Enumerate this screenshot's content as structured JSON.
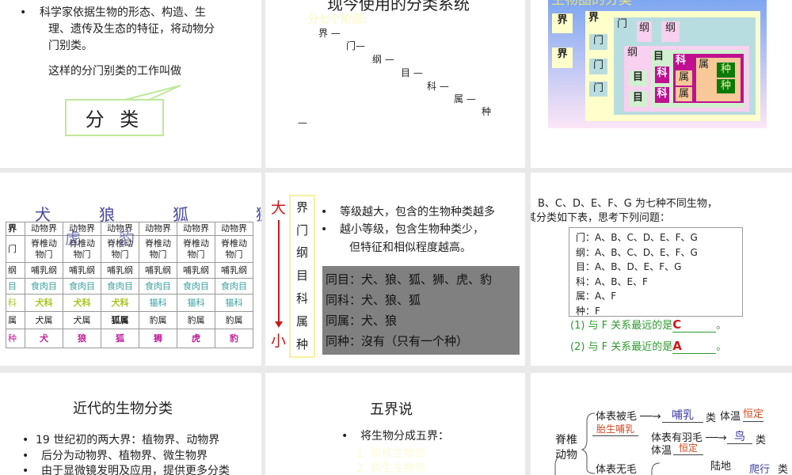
{
  "slide1": {
    "bullet_line1": "科学家依据生物的形态、构造、生",
    "bullet_line2": "理、遗传及生态的特征，将动物分",
    "bullet_line3": "门别类。",
    "line": "这样的分门别类的工作叫做",
    "callout": "分 类"
  },
  "slide2": {
    "title": "现今使用的分类系统",
    "faint_bullet": "分七个阶层:",
    "steps": [
      "界 —",
      "门—",
      "纲 —",
      "目 —",
      "科 —",
      "属 —",
      "种",
      "—"
    ]
  },
  "slide3": {
    "title": "生物圈的分类",
    "kingdom": "界",
    "phylum": "门",
    "class": "纲",
    "order": "目",
    "family": "科",
    "genus": "属",
    "species": "种"
  },
  "slide4": {
    "animals_top": [
      "犬",
      "狼",
      "狐",
      "狮"
    ],
    "animals_overlap": [
      "虎",
      "豹"
    ],
    "rows": [
      [
        "界",
        "动物界",
        "动物界",
        "动物界",
        "动物界",
        "动物界",
        "动物界"
      ],
      [
        "门",
        "脊椎动物门",
        "脊椎动物门",
        "脊椎动物门",
        "脊椎动物门",
        "脊椎动物门",
        "脊椎动物门"
      ],
      [
        "纲",
        "哺乳纲",
        "哺乳纲",
        "哺乳纲",
        "哺乳纲",
        "哺乳纲",
        "哺乳纲"
      ],
      [
        "目",
        "食肉目",
        "食肉目",
        "食肉目",
        "食肉目",
        "食肉目",
        "食肉目"
      ],
      [
        "科",
        "犬科",
        "犬科",
        "犬科",
        "猫科",
        "猫科",
        "猫科"
      ],
      [
        "属",
        "犬属",
        "犬属",
        "狐属",
        "豹属",
        "豹属",
        "豹属"
      ],
      [
        "种",
        "犬",
        "狼",
        "狐",
        "狮",
        "虎",
        "豹"
      ]
    ],
    "colors": {
      "order": "#3aa0a0",
      "canine": "#a8c21c",
      "feline": "#3aa0a0",
      "species": "#c01c9c"
    }
  },
  "slide5": {
    "big": "大",
    "small": "小",
    "ranks": [
      "界",
      "门",
      "纲",
      "目",
      "科",
      "属",
      "种"
    ],
    "bullet1": "等级越大，包含的生物种类越多",
    "bullet2": "越小等级，包含生物种类少，",
    "bullet2b": "但特征和相似程度越高。",
    "box": [
      "同目：犬、狼、狐、狮、虎、豹",
      "同科：犬、狼、狐",
      "同属：犬、狼",
      "同种：沒有（只有一个种）"
    ]
  },
  "slide6": {
    "intro1": "、B、C、D、E、F、G 为七种不同生物，",
    "intro2": "其分类如下表，思考下列问题：",
    "table": [
      "门：A、B、C、D、E、F、G",
      "纲：A、B、C、D、E、F、G",
      "目：A、B、D、E、F、G",
      "科：A、B、E、F",
      "属：A、F",
      "种：F"
    ],
    "q1": "(1) 与 F 关系最远的是",
    "a1": "C",
    "q2": "(2) 与 F 关系最近的是",
    "a2": "A",
    "end": "。"
  },
  "slide7": {
    "title": "近代的生物分类",
    "bullets": [
      "19 世纪初的两大界：植物界、动物界",
      "后分为动物界、植物界、微生物界",
      "由于显微镜发明及应用，提供更多分类"
    ]
  },
  "slide8": {
    "title": "五界说",
    "bullet": "将生物分成五界：",
    "items": [
      "1. 原核生物界",
      "2. 原生生物界"
    ]
  },
  "slide9": {
    "root": "脊椎动物",
    "hair": "体表被毛",
    "mammal": "哺乳",
    "lei": "类",
    "temp": "体温",
    "constant": "恒定",
    "viviparous": "胎生哺乳",
    "feather": "体表有羽毛",
    "bird": "鸟",
    "nohair": "体表无毛",
    "land": "陆地",
    "reptile": "爬行"
  }
}
